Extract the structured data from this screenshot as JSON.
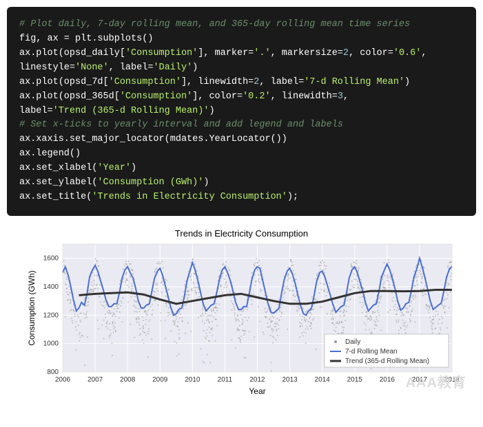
{
  "code": {
    "comment1": "# Plot daily, 7-day rolling mean, and 365-day rolling mean time series",
    "l2": "fig, ax = plt.subplots()",
    "l3a": "ax.plot(opsd_daily[",
    "l3s": "'Consumption'",
    "l3b": "], marker=",
    "l3s2": "'.'",
    "l3c": ", markersize=",
    "l3n": "2",
    "l3d": ", color=",
    "l3s3": "'0.6'",
    "l3e": ",",
    "l4a": "linestyle=",
    "l4s": "'None'",
    "l4b": ", label=",
    "l4s2": "'Daily'",
    "l4c": ")",
    "l5a": "ax.plot(opsd_7d[",
    "l5s": "'Consumption'",
    "l5b": "], linewidth=",
    "l5n": "2",
    "l5c": ", label=",
    "l5s2": "'7-d Rolling Mean'",
    "l5d": ")",
    "l6a": "ax.plot(opsd_365d[",
    "l6s": "'Consumption'",
    "l6b": "], color=",
    "l6s2": "'0.2'",
    "l6c": ", linewidth=",
    "l6n": "3",
    "l6d": ",",
    "l7a": "label=",
    "l7s": "'Trend (365-d Rolling Mean)'",
    "l7b": ")",
    "comment2": "# Set x-ticks to yearly interval and add legend and labels",
    "l9": "ax.xaxis.set_major_locator(mdates.YearLocator())",
    "l10": "ax.legend()",
    "l11a": "ax.set_xlabel(",
    "l11s": "'Year'",
    "l11b": ")",
    "l12a": "ax.set_ylabel(",
    "l12s": "'Consumption (GWh)'",
    "l12b": ")",
    "l13a": "ax.set_title(",
    "l13s": "'Trends in Electricity Consumption'",
    "l13b": ");"
  },
  "chart_data": {
    "type": "line",
    "title": "Trends in Electricity Consumption",
    "xlabel": "Year",
    "ylabel": "Consumption (GWh)",
    "ylim": [
      800,
      1700
    ],
    "yticks": [
      800,
      1000,
      1200,
      1400,
      1600
    ],
    "xticks": [
      2006,
      2007,
      2008,
      2009,
      2010,
      2011,
      2012,
      2013,
      2014,
      2015,
      2016,
      2017,
      2018
    ],
    "x_range": [
      2006,
      2018
    ],
    "legend": [
      "Daily",
      "7-d Rolling Mean",
      "Trend (365-d Rolling Mean)"
    ],
    "series": [
      {
        "name": "Trend (365-d Rolling Mean)",
        "type": "line",
        "color": "#333333",
        "width": 3,
        "x": [
          2006.5,
          2007,
          2007.5,
          2008,
          2008.5,
          2009,
          2009.5,
          2010,
          2010.5,
          2011,
          2011.5,
          2012,
          2012.5,
          2013,
          2013.5,
          2014,
          2014.5,
          2015,
          2015.5,
          2016,
          2016.5,
          2017,
          2017.5,
          2018
        ],
        "y": [
          1340,
          1350,
          1355,
          1360,
          1345,
          1310,
          1280,
          1300,
          1320,
          1340,
          1350,
          1325,
          1300,
          1280,
          1280,
          1295,
          1325,
          1355,
          1370,
          1370,
          1368,
          1370,
          1378,
          1378
        ]
      },
      {
        "name": "7-d Rolling Mean",
        "type": "line",
        "color": "#4a6fd4",
        "width": 2,
        "x": [
          2006,
          2006.08,
          2006.17,
          2006.25,
          2006.33,
          2006.42,
          2006.5,
          2006.58,
          2006.67,
          2006.75,
          2006.83,
          2006.92,
          2007,
          2007.08,
          2007.17,
          2007.25,
          2007.33,
          2007.42,
          2007.5,
          2007.58,
          2007.67,
          2007.75,
          2007.83,
          2007.92,
          2008,
          2008.08,
          2008.17,
          2008.25,
          2008.33,
          2008.42,
          2008.5,
          2008.58,
          2008.67,
          2008.75,
          2008.83,
          2008.92,
          2009,
          2009.08,
          2009.17,
          2009.25,
          2009.33,
          2009.42,
          2009.5,
          2009.58,
          2009.67,
          2009.75,
          2009.83,
          2009.92,
          2010,
          2010.08,
          2010.17,
          2010.25,
          2010.33,
          2010.42,
          2010.5,
          2010.58,
          2010.67,
          2010.75,
          2010.83,
          2010.92,
          2011,
          2011.08,
          2011.17,
          2011.25,
          2011.33,
          2011.42,
          2011.5,
          2011.58,
          2011.67,
          2011.75,
          2011.83,
          2011.92,
          2012,
          2012.08,
          2012.17,
          2012.25,
          2012.33,
          2012.42,
          2012.5,
          2012.58,
          2012.67,
          2012.75,
          2012.83,
          2012.92,
          2013,
          2013.08,
          2013.17,
          2013.25,
          2013.33,
          2013.42,
          2013.5,
          2013.58,
          2013.67,
          2013.75,
          2013.83,
          2013.92,
          2014,
          2014.08,
          2014.17,
          2014.25,
          2014.33,
          2014.42,
          2014.5,
          2014.58,
          2014.67,
          2014.75,
          2014.83,
          2014.92,
          2015,
          2015.08,
          2015.17,
          2015.25,
          2015.33,
          2015.42,
          2015.5,
          2015.58,
          2015.67,
          2015.75,
          2015.83,
          2015.92,
          2016,
          2016.08,
          2016.17,
          2016.25,
          2016.33,
          2016.42,
          2016.5,
          2016.58,
          2016.67,
          2016.75,
          2016.83,
          2016.92,
          2017,
          2017.08,
          2017.17,
          2017.25,
          2017.33,
          2017.42,
          2017.5,
          2017.58,
          2017.67,
          2017.75,
          2017.83,
          2017.92,
          2018
        ],
        "y": [
          1500,
          1540,
          1480,
          1400,
          1310,
          1230,
          1250,
          1290,
          1270,
          1350,
          1470,
          1520,
          1550,
          1510,
          1440,
          1380,
          1310,
          1260,
          1260,
          1280,
          1280,
          1360,
          1460,
          1520,
          1540,
          1500,
          1460,
          1390,
          1300,
          1250,
          1250,
          1270,
          1280,
          1370,
          1460,
          1510,
          1530,
          1480,
          1400,
          1330,
          1255,
          1200,
          1210,
          1240,
          1250,
          1330,
          1440,
          1510,
          1570,
          1520,
          1440,
          1360,
          1280,
          1230,
          1250,
          1270,
          1280,
          1360,
          1450,
          1520,
          1540,
          1500,
          1440,
          1370,
          1290,
          1240,
          1240,
          1260,
          1260,
          1350,
          1450,
          1520,
          1540,
          1530,
          1440,
          1360,
          1280,
          1220,
          1215,
          1230,
          1250,
          1360,
          1450,
          1510,
          1530,
          1490,
          1420,
          1340,
          1270,
          1210,
          1200,
          1230,
          1250,
          1340,
          1440,
          1500,
          1510,
          1470,
          1400,
          1340,
          1275,
          1220,
          1240,
          1260,
          1270,
          1360,
          1460,
          1520,
          1540,
          1500,
          1430,
          1370,
          1290,
          1230,
          1250,
          1270,
          1280,
          1370,
          1470,
          1520,
          1560,
          1520,
          1450,
          1380,
          1295,
          1235,
          1250,
          1280,
          1290,
          1375,
          1470,
          1530,
          1600,
          1540,
          1460,
          1380,
          1300,
          1240,
          1255,
          1270,
          1285,
          1370,
          1465,
          1525,
          1540
        ]
      },
      {
        "name": "Daily",
        "type": "scatter",
        "color": "#999999",
        "marker": ".",
        "size": 2,
        "note": "~4400 daily points spanning 2006-2018, range roughly 850-1680 GWh, seasonal cycle with winter peaks"
      }
    ]
  },
  "watermark": "AAA教育"
}
